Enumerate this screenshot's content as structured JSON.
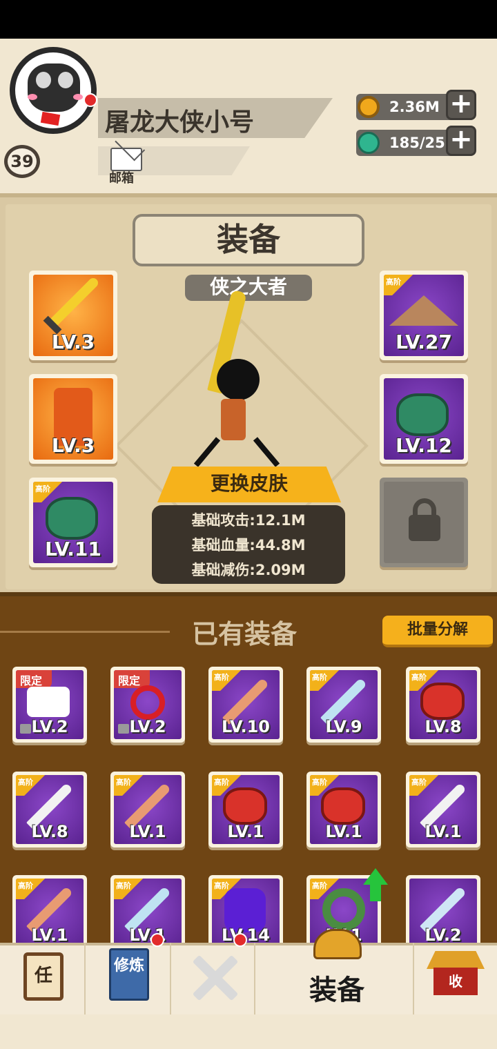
{
  "profile": {
    "name": "屠龙大侠小号",
    "level": "39",
    "mail_label": "邮箱"
  },
  "currencies": [
    {
      "icon": "gold-coin-icon",
      "value": "2.36M",
      "color": "#f0a81c"
    },
    {
      "icon": "jade-gem-icon",
      "value": "185/25",
      "color": "#2fb58f"
    }
  ],
  "equip_panel": {
    "title": "装备",
    "subtitle": "侠之大者",
    "slots_left": [
      {
        "item": "golden-sword",
        "level": "LV.3",
        "tier": "",
        "rarity": "orange"
      },
      {
        "item": "orange-armor",
        "level": "LV.3",
        "tier": "",
        "rarity": "orange"
      },
      {
        "item": "jade-gauntlet",
        "level": "LV.11",
        "tier": "高阶",
        "rarity": "purple"
      }
    ],
    "slots_right": [
      {
        "item": "bamboo-hat",
        "level": "LV.27",
        "tier": "高阶",
        "rarity": "purple"
      },
      {
        "item": "jade-gauntlet",
        "level": "LV.12",
        "tier": "",
        "rarity": "purple"
      },
      {
        "item": "locked-slot",
        "level": "",
        "tier": "",
        "rarity": "gray"
      }
    ],
    "change_skin_label": "更换皮肤",
    "stats": [
      "基础攻击:12.1M",
      "基础血量:44.8M",
      "基础减伤:2.09M"
    ]
  },
  "owned": {
    "title": "已有装备",
    "batch_button": "批量分解",
    "items": [
      {
        "item": "white-scroll",
        "level": "LV.2",
        "tag": "限定",
        "locked": true
      },
      {
        "item": "red-knot",
        "level": "LV.2",
        "tag": "限定",
        "locked": true
      },
      {
        "item": "wood-sword",
        "level": "LV.10",
        "tag": "高阶",
        "locked": false
      },
      {
        "item": "blue-saber",
        "level": "LV.9",
        "tag": "高阶",
        "locked": false
      },
      {
        "item": "red-gauntlet",
        "level": "LV.8",
        "tag": "高阶",
        "locked": false
      },
      {
        "item": "white-saber",
        "level": "LV.8",
        "tag": "高阶",
        "locked": false
      },
      {
        "item": "wood-sword",
        "level": "LV.1",
        "tag": "高阶",
        "locked": false
      },
      {
        "item": "red-gauntlet",
        "level": "LV.1",
        "tag": "高阶",
        "locked": false
      },
      {
        "item": "red-gauntlet",
        "level": "LV.1",
        "tag": "高阶",
        "locked": false
      },
      {
        "item": "white-saber",
        "level": "LV.1",
        "tag": "高阶",
        "locked": false
      },
      {
        "item": "wood-sword",
        "level": "LV.1",
        "tag": "高阶",
        "locked": false
      },
      {
        "item": "blue-saber",
        "level": "LV.1",
        "tag": "高阶",
        "locked": false
      },
      {
        "item": "purple-pot",
        "level": "LV.14",
        "tag": "高阶",
        "locked": false
      },
      {
        "item": "jade-ring",
        "level": "LV.1",
        "tag": "高阶",
        "locked": false
      },
      {
        "item": "blue-sword",
        "level": "LV.2",
        "tag": "",
        "locked": false
      }
    ]
  },
  "nav": {
    "items": [
      {
        "icon": "task-scroll-icon",
        "glyph": "任"
      },
      {
        "icon": "cultivation-book-icon",
        "glyph": "修炼"
      },
      {
        "icon": "crossed-swords-icon",
        "glyph": ""
      },
      {
        "icon": "equipment-helmet-icon",
        "label": "装备"
      },
      {
        "icon": "collection-house-icon",
        "glyph": "收"
      }
    ]
  }
}
